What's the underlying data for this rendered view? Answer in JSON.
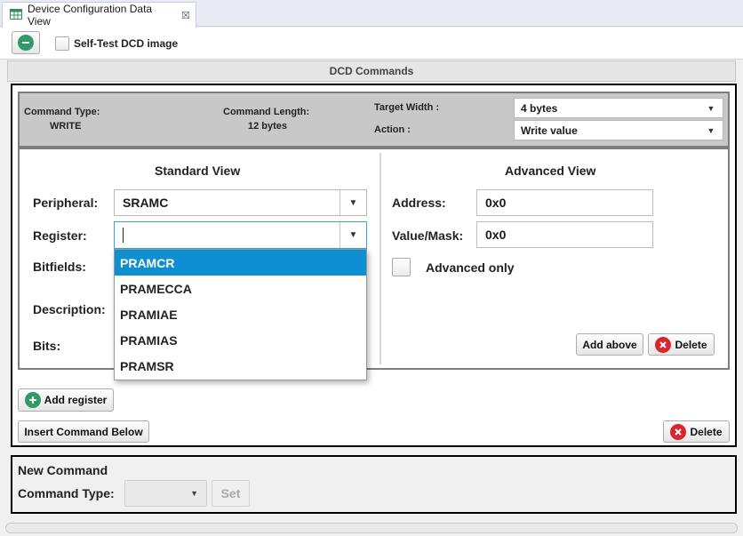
{
  "tab": {
    "title": "Device Configuration Data View",
    "close_symbol": "☒"
  },
  "toolbar": {
    "self_test_label": "Self-Test DCD image",
    "self_test_checked": false
  },
  "section": {
    "title": "DCD Commands"
  },
  "command_info": {
    "command_type_label": "Command Type:",
    "command_type_value": "WRITE",
    "command_length_label": "Command Length:",
    "command_length_value": "12 bytes",
    "target_width_label": "Target Width :",
    "target_width_value": "4 bytes",
    "action_label": "Action :",
    "action_value": "Write value"
  },
  "standard_view": {
    "title": "Standard View",
    "peripheral_label": "Peripheral:",
    "peripheral_value": "SRAMC",
    "register_label": "Register:",
    "register_value": "",
    "bitfields_label": "Bitfields:",
    "description_label": "Description:",
    "bits_label": "Bits:"
  },
  "register_dropdown": {
    "options": [
      "PRAMCR",
      "PRAMECCA",
      "PRAMIAE",
      "PRAMIAS",
      "PRAMSR"
    ],
    "selected_index": 0
  },
  "advanced_view": {
    "title": "Advanced View",
    "address_label": "Address:",
    "address_value": "0x0",
    "value_mask_label": "Value/Mask:",
    "value_mask_value": "0x0",
    "advanced_only_label": "Advanced only",
    "advanced_only_checked": false,
    "add_above_label": "Add above",
    "delete_label": "Delete"
  },
  "actions": {
    "add_register_label": "Add register",
    "insert_command_label": "Insert Command Below",
    "delete_label": "Delete"
  },
  "new_command": {
    "title": "New Command",
    "command_type_label": "Command Type:",
    "command_type_value": "",
    "set_label": "Set"
  },
  "colors": {
    "accent": "#0f8fd1",
    "add_green": "#2f9b66",
    "delete_red": "#d9262d"
  }
}
